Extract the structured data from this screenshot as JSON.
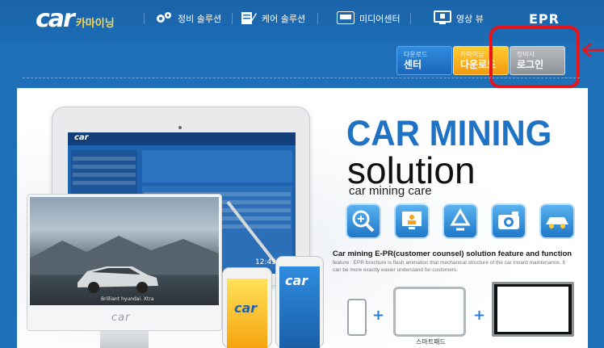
{
  "header": {
    "logo_text": "car",
    "logo_sub": "카마이닝",
    "nav": [
      {
        "label": "정비 솔루션",
        "icon": "gears-icon"
      },
      {
        "label": "케어 솔루션",
        "icon": "notepad-icon"
      },
      {
        "label": "미디어센터",
        "icon": "media-icon"
      },
      {
        "label": "영상 뷰",
        "icon": "monitor-icon"
      },
      {
        "label": "EPR",
        "icon": ""
      }
    ]
  },
  "subnav": {
    "download": {
      "small": "다운로드",
      "big": "센터"
    },
    "carmining": {
      "small": "카마이닝",
      "big": "다운로드"
    },
    "login": {
      "small": "정비사",
      "big": "로그인"
    }
  },
  "hero": {
    "title": "CAR MINING",
    "solution": "solution",
    "care": "car mining care",
    "features": [
      "search-plus-icon",
      "monitor-user-icon",
      "recycle-icon",
      "camera-icon",
      "car-icon"
    ],
    "desc_title": "Car mining E-PR(customer counsel) solution feature and function",
    "desc_body": "feature : EPR brochure is flash animation that mechanical structure of the car innard maintenance. It can be more exactly easier understand for customers.",
    "tablet_logo": "car",
    "monitor_brand": "car",
    "monitor_caption": "Brilliant hyundai. Xtra",
    "phone_time": "12:45",
    "phone1_logo": "car",
    "phone2_logo": "car",
    "device_label": "스마트패드"
  },
  "colors": {
    "background": "#1e6fb8",
    "accent_blue": "#1e73c4",
    "highlight_red": "#e8141a",
    "download_btn": "#2f8ce0",
    "carmining_btn": "#f39a10",
    "login_btn": "#9a9ea3"
  }
}
